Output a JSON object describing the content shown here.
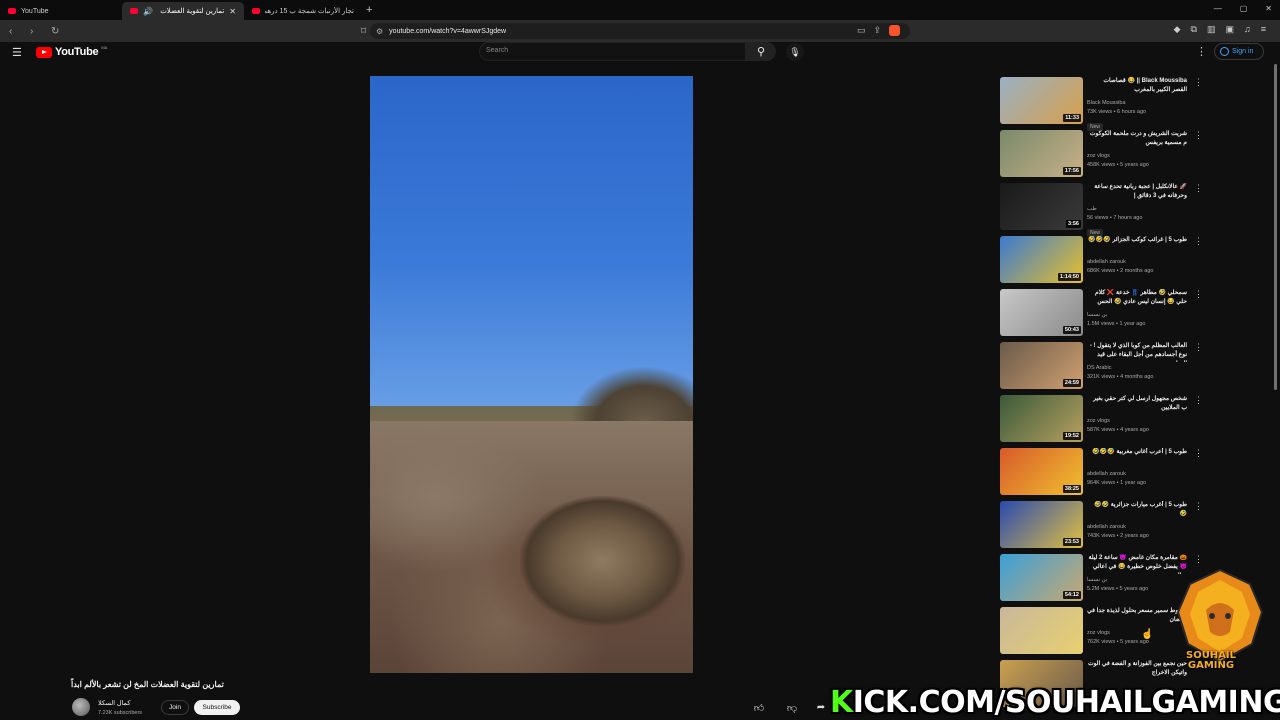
{
  "browser": {
    "tabs": [
      {
        "title": "YouTube",
        "active": false
      },
      {
        "title": "تمارين لتقوية العضلات المخ لن",
        "active": true
      },
      {
        "title": "تجار الأرنبات شمجة ب 15 درهم 🤩 وارك",
        "active": false
      }
    ],
    "url": "youtube.com/watch?v=4awwrSJgdew"
  },
  "masthead": {
    "logo_text": "YouTube",
    "logo_country": "MA",
    "search_placeholder": "Search",
    "signin_label": "Sign in"
  },
  "video": {
    "title": "تمارين لتقوية العضلات المخ لن تشعر بالألم ابداً",
    "channel_name": "كمال السكلا",
    "subscribers": "7.23K subscribers",
    "join_label": "Join",
    "subscribe_label": "Subscribe"
  },
  "related": [
    {
      "title": "Black Moussiba || 😂 قصاصات القصر الكبير بالمغرب",
      "channel": "Black Moussiba",
      "meta": "73K views • 6 hours ago",
      "badge": "New",
      "duration": "11:33",
      "thumb_colors": [
        "#9ab0c4",
        "#d8a04a"
      ]
    },
    {
      "title": "شريت الشريش و درت ملحمة الكوكوت م مسمية بريفس",
      "channel": "zoz vlogs",
      "meta": "458K views • 5 years ago",
      "badge": "",
      "duration": "17:56",
      "thumb_colors": [
        "#7a8a6a",
        "#c8b088"
      ]
    },
    {
      "title": "🚀 عالانكلبل | عجبة ربانية تحدع ساعة وحرفانه في 3 دقائق |",
      "channel": "طب",
      "meta": "56 views • 7 hours ago",
      "badge": "New",
      "duration": "3:56",
      "thumb_colors": [
        "#1a1a1a",
        "#3a3a3a"
      ]
    },
    {
      "title": "طوب 5 | غرائب كوكب الجزائر 🤣🤣🤣",
      "channel": "abdellah zarouk",
      "meta": "686K views • 2 months ago",
      "badge": "",
      "duration": "1:14:50",
      "thumb_colors": [
        "#3a7ad0",
        "#e8c02a"
      ]
    },
    {
      "title": "سمحلي 🤣 مطاهر 👖 خدعة ❌ كلام حلي 😂 إنسان ليس عادي 🤣 الحس",
      "channel": "بن نسسا",
      "meta": "1.5M views • 1 year ago",
      "badge": "",
      "duration": "50:43",
      "thumb_colors": [
        "#c8c8c8",
        "#8a8a8a"
      ]
    },
    {
      "title": "العالب المظلم من كوبا الذي لا يتقول ! - نوع أجسادهم من أجل البقاء على قيد الحياة -",
      "channel": "DS Arabic",
      "meta": "321K views • 4 months ago",
      "badge": "",
      "duration": "24:59",
      "thumb_colors": [
        "#6a5a4a",
        "#d0a070"
      ]
    },
    {
      "title": "شخص مجهول ارسل لي كتر حقي بغير ب الملايين",
      "channel": "zoz vlogs",
      "meta": "587K views • 4 years ago",
      "badge": "",
      "duration": "19:52",
      "thumb_colors": [
        "#3a5a3a",
        "#b8a060"
      ]
    },
    {
      "title": "طوب 5 | أعرب أغاني مغربية 🤣🤣🤣",
      "channel": "abdellah zarouk",
      "meta": "964K views • 1 year ago",
      "badge": "",
      "duration": "38:25",
      "thumb_colors": [
        "#d85a2a",
        "#f0c030"
      ]
    },
    {
      "title": "طوب 5 | أغرب ميارات جزائرية 🤣🤣🤣",
      "channel": "abdellah zarouk",
      "meta": "743K views • 2 years ago",
      "badge": "",
      "duration": "23:53",
      "thumb_colors": [
        "#2a4ab0",
        "#e0c040"
      ]
    },
    {
      "title": "🎃 مقامرة مكان غامض 😈 ساعة 2 ليلة 😈 يفضل خلوص خطيرة 😂 في اعالي جبال",
      "channel": "بن نسسا",
      "meta": "5.2M views • 5 years ago",
      "badge": "",
      "duration": "54:12",
      "thumb_colors": [
        "#3aa0d8",
        "#c8a870"
      ]
    },
    {
      "title": "طبلوط سمير مسعر بحلول لذيذة جدا في رمضان",
      "channel": "zoz vlogs",
      "meta": "762K views • 5 years ago",
      "badge": "",
      "duration": "",
      "thumb_colors": [
        "#c8b89a",
        "#e8d070"
      ]
    },
    {
      "title": "حين نجمع بين الفوزانة و الفضة في الوت واتيكن الاخراج",
      "channel": "",
      "meta": "",
      "badge": "",
      "duration": "",
      "thumb_colors": [
        "#caa050",
        "#6a5a4a"
      ]
    }
  ],
  "overlay": {
    "brand_line1": "SOUHAIL",
    "brand_line2": "GAMING",
    "kick_prefix": "K",
    "kick_rest": "ICK.COM/SOUHAILGAMING"
  },
  "colors": {
    "background": "#0f0f0f",
    "brand_red": "#ff0000",
    "link_blue": "#3ea6ff",
    "kick_green": "#53fc18"
  }
}
